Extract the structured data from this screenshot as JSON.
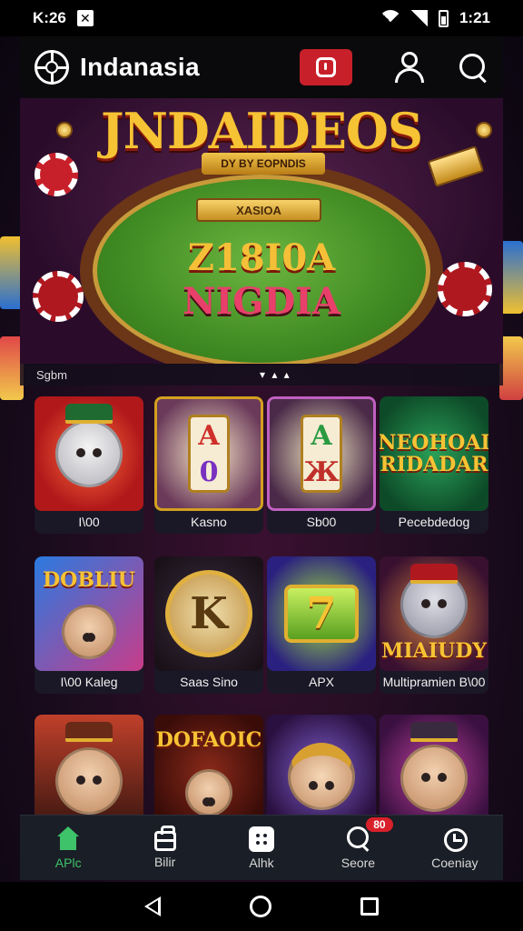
{
  "status": {
    "left_text": "K:26",
    "time": "1:21"
  },
  "header": {
    "title": "Indanasia"
  },
  "hero": {
    "title": "JNDAIDEOS",
    "subtitle": "DY BY EOPNDIS",
    "plaque": "XASIOA",
    "line1": "Z18I0A",
    "line2": "NIGDIA"
  },
  "section": {
    "label": "Sgbm",
    "arrows": "▾ ▴ ▴"
  },
  "games": [
    {
      "label": "I\\00",
      "art": ""
    },
    {
      "label": "Kasno",
      "art": ""
    },
    {
      "label": "Sb00",
      "art": ""
    },
    {
      "label": "Pecebdedog",
      "art": "NEOHOAI RIDADAR"
    },
    {
      "label": "I\\00 Kaleg",
      "art": "DOBLIU"
    },
    {
      "label": "Saas Sino",
      "art": ""
    },
    {
      "label": "APX",
      "art": ""
    },
    {
      "label": "Multipramien B\\00",
      "art": "MIAIUDY"
    },
    {
      "label": "",
      "art": ""
    },
    {
      "label": "",
      "art": "DOFAOIC"
    },
    {
      "label": "",
      "art": ""
    },
    {
      "label": "",
      "art": ""
    }
  ],
  "reels": {
    "game2": [
      "A",
      "0"
    ],
    "game3": [
      "A",
      "Ж"
    ],
    "dial": "K",
    "seven": "7"
  },
  "bottom_nav": [
    {
      "label": "APlc",
      "icon": "home-icon",
      "active": true
    },
    {
      "label": "Bilir",
      "icon": "bag-icon",
      "active": false
    },
    {
      "label": "Alhk",
      "icon": "grid-icon",
      "active": false
    },
    {
      "label": "Seore",
      "icon": "search-icon",
      "active": false,
      "badge": "80"
    },
    {
      "label": "Coeniay",
      "icon": "clock-icon",
      "active": false
    }
  ],
  "colors": {
    "accent_red": "#c8202a",
    "active_green": "#3ec26a",
    "gold": "#f6c334"
  }
}
